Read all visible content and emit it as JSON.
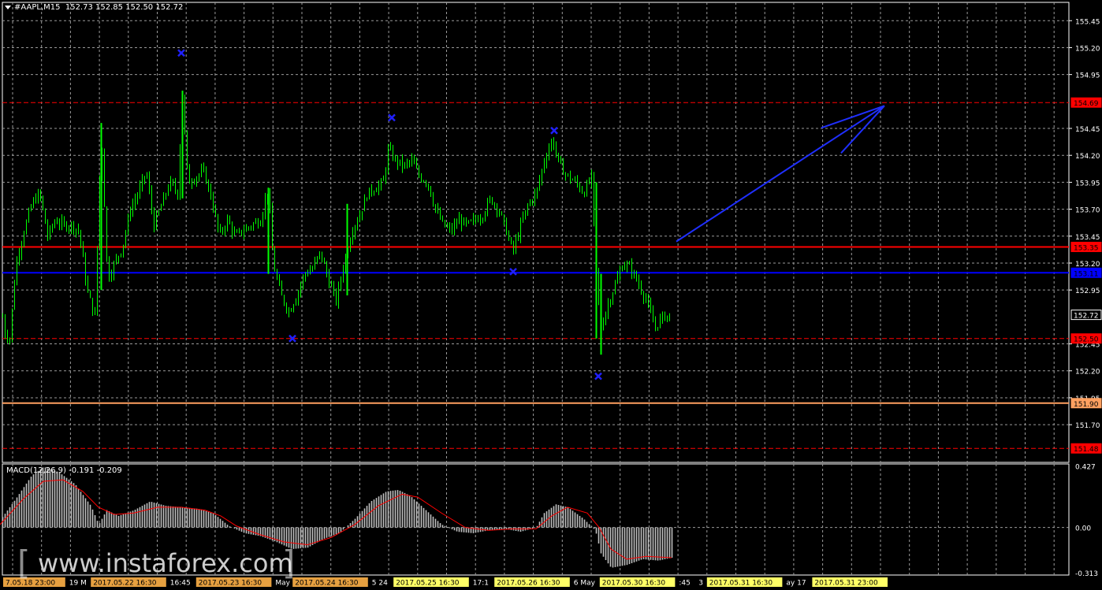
{
  "header": {
    "symbol_tf": "#AAPL,M15",
    "ohlc": "152.73 152.85 152.50 152.72"
  },
  "macd": {
    "label": "MACD(12,26,9) -0.191 -0.209",
    "axis_labels": [
      "0.427",
      "0.00",
      "-0.313"
    ]
  },
  "watermark": {
    "text": "www.instaforex.com"
  },
  "colors": {
    "candle": "#00ff00",
    "grid": "#c8c8c8",
    "level_red": "#ff0000",
    "level_blue": "#0000ff",
    "level_orange": "#ffa060",
    "signal": "#ff0000",
    "histogram": "#c0c0c0",
    "date_tag": "#ffff66",
    "date_tag_alt": "#e6a040"
  },
  "chart_data": {
    "type": "candlestick",
    "title": "",
    "ylim": [
      151.35,
      155.62
    ],
    "price_axis_labels": [
      "155.45",
      "155.20",
      "154.95",
      "154.45",
      "154.20",
      "153.95",
      "153.70",
      "153.45",
      "153.20",
      "152.95",
      "152.45",
      "152.20",
      "151.95",
      "151.70"
    ],
    "price_tags": [
      {
        "text": "154.69",
        "value": 154.69,
        "style": "dashed",
        "color": "#ff0000"
      },
      {
        "text": "153.35",
        "value": 153.35,
        "style": "solid",
        "color": "#ff0000"
      },
      {
        "text": "153.11",
        "value": 153.11,
        "style": "solid",
        "color": "#0000ff"
      },
      {
        "text": "152.72",
        "value": 152.72,
        "style": "current",
        "color": "#000000"
      },
      {
        "text": "152.50",
        "value": 152.5,
        "style": "dashed",
        "color": "#ff0000"
      },
      {
        "text": "151.90",
        "value": 151.9,
        "style": "solid",
        "color": "#ffa060"
      },
      {
        "text": "151.48",
        "value": 151.48,
        "style": "dashed",
        "color": "#ff0000"
      }
    ],
    "time_labels": [
      {
        "text": "7.05.18 23:00",
        "tag": "alt"
      },
      {
        "text": "19 M",
        "tag": "none"
      },
      {
        "text": "2017.05.22 16:30",
        "tag": "alt"
      },
      {
        "text": "16:45",
        "tag": "none"
      },
      {
        "text": "2017.05.23 16:30",
        "tag": "alt"
      },
      {
        "text": "May",
        "tag": "none"
      },
      {
        "text": "2017.05.24 16:30",
        "tag": "alt"
      },
      {
        "text": "5 24",
        "tag": "none"
      },
      {
        "text": "2017.05.25 16:30",
        "tag": "yellow"
      },
      {
        "text": "17:1",
        "tag": "none"
      },
      {
        "text": "2017.05.26 16:30",
        "tag": "yellow"
      },
      {
        "text": "6 May",
        "tag": "none"
      },
      {
        "text": "2017.05.30 16:30",
        "tag": "yellow"
      },
      {
        "text": ":45",
        "tag": "none"
      },
      {
        "text": "3",
        "tag": "none"
      },
      {
        "text": "2017.05.31 16:30",
        "tag": "yellow"
      },
      {
        "text": "ay 17",
        "tag": "none"
      },
      {
        "text": "2017.05.31 23:00",
        "tag": "yellow"
      }
    ],
    "close_path": [
      [
        0,
        152.85
      ],
      [
        6,
        152.55
      ],
      [
        12,
        152.5
      ],
      [
        20,
        153.2
      ],
      [
        30,
        153.5
      ],
      [
        40,
        153.75
      ],
      [
        50,
        153.85
      ],
      [
        60,
        153.45
      ],
      [
        70,
        153.6
      ],
      [
        80,
        153.55
      ],
      [
        90,
        153.55
      ],
      [
        100,
        153.5
      ],
      [
        110,
        152.95
      ],
      [
        120,
        152.7
      ],
      [
        128,
        154.45
      ],
      [
        136,
        153.05
      ],
      [
        145,
        153.2
      ],
      [
        155,
        153.35
      ],
      [
        165,
        153.7
      ],
      [
        175,
        153.85
      ],
      [
        185,
        154.05
      ],
      [
        195,
        153.55
      ],
      [
        205,
        153.75
      ],
      [
        215,
        153.95
      ],
      [
        225,
        153.85
      ],
      [
        231,
        154.75
      ],
      [
        238,
        153.95
      ],
      [
        248,
        154.0
      ],
      [
        258,
        154.05
      ],
      [
        268,
        153.8
      ],
      [
        278,
        153.45
      ],
      [
        288,
        153.6
      ],
      [
        298,
        153.45
      ],
      [
        308,
        153.5
      ],
      [
        318,
        153.55
      ],
      [
        330,
        153.6
      ],
      [
        340,
        153.9
      ],
      [
        346,
        153.2
      ],
      [
        356,
        152.9
      ],
      [
        366,
        152.75
      ],
      [
        376,
        152.9
      ],
      [
        386,
        153.1
      ],
      [
        396,
        153.15
      ],
      [
        406,
        153.3
      ],
      [
        416,
        153.05
      ],
      [
        426,
        152.85
      ],
      [
        436,
        153.2
      ],
      [
        446,
        153.5
      ],
      [
        456,
        153.65
      ],
      [
        466,
        153.85
      ],
      [
        476,
        153.9
      ],
      [
        486,
        153.95
      ],
      [
        492,
        154.25
      ],
      [
        502,
        154.15
      ],
      [
        512,
        154.1
      ],
      [
        522,
        154.15
      ],
      [
        532,
        154.0
      ],
      [
        542,
        153.95
      ],
      [
        552,
        153.7
      ],
      [
        562,
        153.55
      ],
      [
        572,
        153.5
      ],
      [
        582,
        153.6
      ],
      [
        592,
        153.55
      ],
      [
        602,
        153.6
      ],
      [
        612,
        153.65
      ],
      [
        622,
        153.8
      ],
      [
        632,
        153.7
      ],
      [
        642,
        153.5
      ],
      [
        650,
        153.3
      ],
      [
        660,
        153.55
      ],
      [
        670,
        153.75
      ],
      [
        680,
        153.85
      ],
      [
        690,
        154.15
      ],
      [
        700,
        154.35
      ],
      [
        710,
        154.1
      ],
      [
        720,
        154.0
      ],
      [
        730,
        153.95
      ],
      [
        740,
        153.85
      ],
      [
        750,
        154.0
      ],
      [
        756,
        153.1
      ],
      [
        762,
        152.6
      ],
      [
        770,
        152.8
      ],
      [
        780,
        153.0
      ],
      [
        790,
        153.2
      ],
      [
        800,
        153.15
      ],
      [
        810,
        153.0
      ],
      [
        820,
        152.85
      ],
      [
        830,
        152.6
      ],
      [
        840,
        152.7
      ],
      [
        850,
        152.72
      ]
    ],
    "markers": [
      {
        "x_bar": 230,
        "value": 155.15
      },
      {
        "x_bar": 371,
        "value": 152.5
      },
      {
        "x_bar": 497,
        "value": 154.55
      },
      {
        "x_bar": 651,
        "value": 153.12
      },
      {
        "x_bar": 703,
        "value": 154.43
      },
      {
        "x_bar": 759,
        "value": 152.15
      }
    ],
    "arrow": {
      "from_bar": 858,
      "from_value": 153.4,
      "to_bar": 1122,
      "to_value": 154.66
    },
    "macd_histogram": {
      "ylim": [
        -0.33,
        0.44
      ],
      "points": [
        [
          0,
          0.05
        ],
        [
          20,
          0.2
        ],
        [
          40,
          0.36
        ],
        [
          55,
          0.42
        ],
        [
          75,
          0.38
        ],
        [
          95,
          0.3
        ],
        [
          115,
          0.15
        ],
        [
          125,
          0.02
        ],
        [
          135,
          0.12
        ],
        [
          150,
          0.08
        ],
        [
          170,
          0.12
        ],
        [
          190,
          0.18
        ],
        [
          210,
          0.15
        ],
        [
          230,
          0.14
        ],
        [
          250,
          0.13
        ],
        [
          270,
          0.1
        ],
        [
          290,
          0.01
        ],
        [
          310,
          -0.04
        ],
        [
          330,
          -0.06
        ],
        [
          350,
          -0.1
        ],
        [
          370,
          -0.15
        ],
        [
          390,
          -0.14
        ],
        [
          410,
          -0.08
        ],
        [
          430,
          -0.04
        ],
        [
          450,
          0.06
        ],
        [
          470,
          0.18
        ],
        [
          490,
          0.25
        ],
        [
          505,
          0.26
        ],
        [
          520,
          0.22
        ],
        [
          540,
          0.12
        ],
        [
          560,
          0.02
        ],
        [
          580,
          -0.03
        ],
        [
          600,
          -0.04
        ],
        [
          620,
          -0.02
        ],
        [
          640,
          -0.01
        ],
        [
          660,
          -0.03
        ],
        [
          680,
          0.0
        ],
        [
          690,
          0.1
        ],
        [
          705,
          0.16
        ],
        [
          720,
          0.14
        ],
        [
          740,
          0.06
        ],
        [
          755,
          -0.02
        ],
        [
          762,
          -0.18
        ],
        [
          775,
          -0.28
        ],
        [
          795,
          -0.26
        ],
        [
          815,
          -0.22
        ],
        [
          835,
          -0.23
        ],
        [
          852,
          -0.21
        ]
      ]
    },
    "macd_signal": {
      "points": [
        [
          0,
          0.02
        ],
        [
          30,
          0.2
        ],
        [
          55,
          0.32
        ],
        [
          80,
          0.33
        ],
        [
          105,
          0.25
        ],
        [
          125,
          0.14
        ],
        [
          145,
          0.09
        ],
        [
          170,
          0.1
        ],
        [
          200,
          0.14
        ],
        [
          230,
          0.14
        ],
        [
          260,
          0.12
        ],
        [
          280,
          0.08
        ],
        [
          300,
          0.01
        ],
        [
          330,
          -0.05
        ],
        [
          360,
          -0.1
        ],
        [
          390,
          -0.12
        ],
        [
          420,
          -0.07
        ],
        [
          450,
          0.02
        ],
        [
          480,
          0.15
        ],
        [
          510,
          0.23
        ],
        [
          530,
          0.21
        ],
        [
          560,
          0.1
        ],
        [
          590,
          0.0
        ],
        [
          620,
          -0.02
        ],
        [
          650,
          -0.01
        ],
        [
          680,
          -0.01
        ],
        [
          700,
          0.08
        ],
        [
          720,
          0.14
        ],
        [
          745,
          0.1
        ],
        [
          760,
          0.0
        ],
        [
          775,
          -0.15
        ],
        [
          795,
          -0.22
        ],
        [
          820,
          -0.2
        ],
        [
          852,
          -0.21
        ]
      ]
    }
  }
}
